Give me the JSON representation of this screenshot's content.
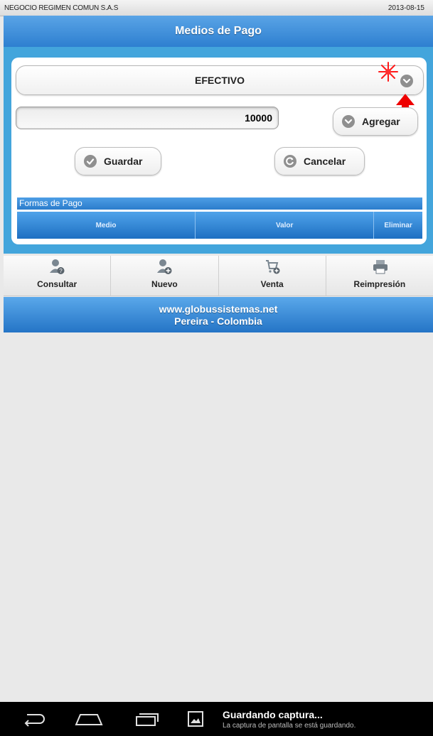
{
  "topbar": {
    "company": "NEGOCIO REGIMEN COMUN S.A.S",
    "date": "2013-08-15"
  },
  "header": {
    "title": "Medios de Pago"
  },
  "payment": {
    "selected_method": "EFECTIVO",
    "amount": "10000",
    "add_label": "Agregar",
    "save_label": "Guardar",
    "cancel_label": "Cancelar"
  },
  "forms_table": {
    "title": "Formas de Pago",
    "columns": [
      "Medio",
      "Valor",
      "Eliminar"
    ]
  },
  "nav": {
    "items": [
      {
        "label": "Consultar",
        "icon": "user-question-icon"
      },
      {
        "label": "Nuevo",
        "icon": "user-add-icon"
      },
      {
        "label": "Venta",
        "icon": "cart-add-icon"
      },
      {
        "label": "Reimpresión",
        "icon": "printer-icon"
      }
    ]
  },
  "footer": {
    "line1": "www.globussistemas.net",
    "line2": "Pereira - Colombia"
  },
  "system_bar": {
    "notification_title": "Guardando captura...",
    "notification_text": "La captura de pantalla se está guardando."
  },
  "colors": {
    "accent_blue": "#2e7fd0",
    "frame_blue": "#43a5dc",
    "marker_red": "#ff0000"
  }
}
